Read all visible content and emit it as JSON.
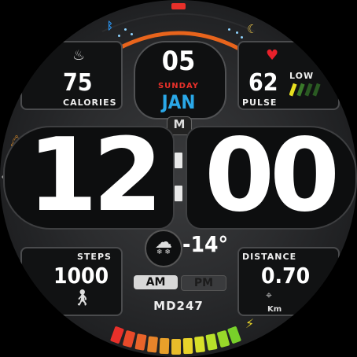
{
  "date": {
    "day": "05",
    "weekday": "SUNDAY",
    "month": "JAN"
  },
  "calories": {
    "value": "75",
    "label": "CALORIES"
  },
  "pulse": {
    "value": "62",
    "label": "PULSE",
    "level": "LOW"
  },
  "time": {
    "hours": "12",
    "minutes": "00"
  },
  "weather": {
    "temperature": "-14°"
  },
  "steps": {
    "value": "1000",
    "label": "STEPS"
  },
  "distance": {
    "value": "0.70",
    "label": "DISTANCE",
    "unit": "Km"
  },
  "ampm": {
    "am": "AM",
    "pm": "PM",
    "active": "AM"
  },
  "brand": {
    "name": "MD247",
    "logo": "M"
  },
  "battery": {
    "segments": 12,
    "level": 1.0
  },
  "colors": {
    "accent_orange": "#e8641c",
    "month_blue": "#2aa8e8",
    "weekday_red": "#e8302a",
    "heart_red": "#e8202a"
  },
  "icons": [
    "bluetooth-icon",
    "moon-icon",
    "flame-icon",
    "heart-icon",
    "bell-icon",
    "weather-snow-icon",
    "walker-icon",
    "location-pin-icon",
    "lightning-icon"
  ]
}
